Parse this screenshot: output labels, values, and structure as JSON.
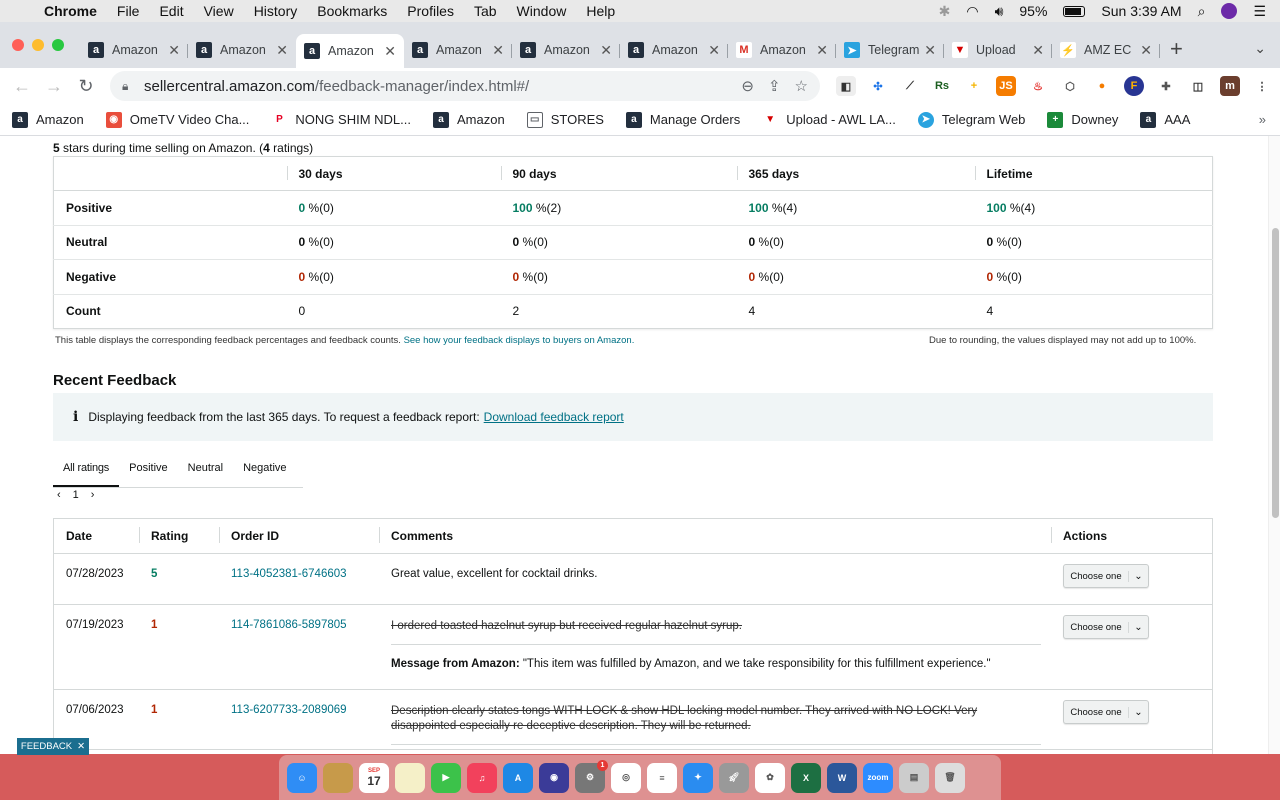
{
  "menubar": {
    "app_name": "Chrome",
    "items": [
      "File",
      "Edit",
      "View",
      "History",
      "Bookmarks",
      "Profiles",
      "Tab",
      "Window",
      "Help"
    ],
    "battery": "95%",
    "clock": "Sun 3:39 AM"
  },
  "tabs": [
    {
      "label": "Amazon",
      "favicon": "amazon-icon",
      "active": false
    },
    {
      "label": "Amazon",
      "favicon": "amazon-icon",
      "active": false
    },
    {
      "label": "Amazon",
      "favicon": "amazon-icon",
      "active": true
    },
    {
      "label": "Amazon",
      "favicon": "amazon-icon",
      "active": false
    },
    {
      "label": "Amazon",
      "favicon": "amazon-icon",
      "active": false
    },
    {
      "label": "Amazon",
      "favicon": "amazon-icon",
      "active": false
    },
    {
      "label": "Amazon",
      "favicon": "gmail-icon",
      "active": false
    },
    {
      "label": "Telegram",
      "favicon": "telegram-icon",
      "active": false
    },
    {
      "label": "Upload",
      "favicon": "upload-icon",
      "active": false
    },
    {
      "label": "AMZ EC",
      "favicon": "amz-ec-icon",
      "active": false
    }
  ],
  "omnibox": {
    "host": "sellercentral.amazon.com",
    "path": "/feedback-manager/index.html#/"
  },
  "bookmarks": [
    {
      "label": "Amazon",
      "icon": "amazon-icon"
    },
    {
      "label": "OmeTV Video Cha...",
      "icon": "ometv-icon"
    },
    {
      "label": "NONG SHIM NDL...",
      "icon": "pinterest-icon"
    },
    {
      "label": "Amazon",
      "icon": "amazon-icon"
    },
    {
      "label": "STORES",
      "icon": "folder-icon"
    },
    {
      "label": "Manage Orders",
      "icon": "amazon-icon"
    },
    {
      "label": "Upload - AWL LA...",
      "icon": "upload-icon"
    },
    {
      "label": "Telegram Web",
      "icon": "telegram-icon"
    },
    {
      "label": "Downey",
      "icon": "downey-icon"
    },
    {
      "label": "AAA",
      "icon": "amazon-icon"
    }
  ],
  "summary": {
    "lead": "5",
    "text_a": " stars during time selling on Amazon. (",
    "count": "4",
    "text_b": " ratings)"
  },
  "stats": {
    "headers": [
      "30 days",
      "90 days",
      "365 days",
      "Lifetime"
    ],
    "rows": [
      {
        "label": "Positive",
        "cells": [
          {
            "v": "0",
            "s": " %(0)",
            "c": "g"
          },
          {
            "v": "100",
            "s": " %(2)",
            "c": "g"
          },
          {
            "v": "100",
            "s": " %(4)",
            "c": "g"
          },
          {
            "v": "100",
            "s": " %(4)",
            "c": "g"
          }
        ]
      },
      {
        "label": "Neutral",
        "cells": [
          {
            "v": "0",
            "s": " %(0)",
            "c": ""
          },
          {
            "v": "0",
            "s": " %(0)",
            "c": ""
          },
          {
            "v": "0",
            "s": " %(0)",
            "c": ""
          },
          {
            "v": "0",
            "s": " %(0)",
            "c": ""
          }
        ]
      },
      {
        "label": "Negative",
        "cells": [
          {
            "v": "0",
            "s": " %(0)",
            "c": "r"
          },
          {
            "v": "0",
            "s": " %(0)",
            "c": "r"
          },
          {
            "v": "0",
            "s": " %(0)",
            "c": "r"
          },
          {
            "v": "0",
            "s": " %(0)",
            "c": "r"
          }
        ]
      },
      {
        "label": "Count",
        "cells": [
          {
            "v": "",
            "s": "0",
            "c": ""
          },
          {
            "v": "",
            "s": "2",
            "c": ""
          },
          {
            "v": "",
            "s": "4",
            "c": ""
          },
          {
            "v": "",
            "s": "4",
            "c": ""
          }
        ]
      }
    ],
    "note_left": "This table displays the corresponding feedback percentages and feedback counts.",
    "note_left_link": "See how your feedback displays to buyers on Amazon.",
    "note_right": "Due to rounding, the values displayed may not add up to 100%."
  },
  "recent": {
    "title": "Recent Feedback",
    "info_text": "Displaying feedback from the last 365 days. To request a feedback report:",
    "info_link": "Download feedback report",
    "filter_tabs": [
      "All ratings",
      "Positive",
      "Neutral",
      "Negative"
    ],
    "page": "1",
    "columns": [
      "Date",
      "Rating",
      "Order ID",
      "Comments",
      "Actions"
    ],
    "rows": [
      {
        "date": "07/28/2023",
        "rating": "5",
        "rating_color": "g",
        "order_id": "113-4052381-6746603",
        "comment": "Great value, excellent for cocktail drinks.",
        "struck": false,
        "amazon_label": "",
        "amazon_msg": "",
        "action": "Choose one"
      },
      {
        "date": "07/19/2023",
        "rating": "1",
        "rating_color": "r",
        "order_id": "114-7861086-5897805",
        "comment": "I ordered toasted hazelnut syrup but received regular hazelnut syrup.",
        "struck": true,
        "amazon_label": "Message from Amazon:",
        "amazon_msg": " \"This item was fulfilled by Amazon, and we take responsibility for this fulfillment experience.\"",
        "action": "Choose one"
      },
      {
        "date": "07/06/2023",
        "rating": "1",
        "rating_color": "r",
        "order_id": "113-6207733-2089069",
        "comment": "Description clearly states tongs WITH LOCK & show HDL locking model number. They arrived with NO LOCK! Very disappointed especially re deceptive description. They will be returned.",
        "struck": true,
        "amazon_label": "",
        "amazon_msg": "",
        "action": "Choose one"
      }
    ]
  },
  "feedback_tab": "FEEDBACK",
  "colors": {
    "positive": "#067d62",
    "negative": "#b12704",
    "link": "#007185",
    "desktop": "#d65b5b"
  },
  "dock": [
    "finder-icon",
    "notes-icon",
    "calendar-icon",
    "stickies-icon",
    "facetime-icon",
    "music-icon",
    "app-store-icon",
    "siri-icon",
    "system-preferences-icon",
    "chrome-icon",
    "reminders-icon",
    "safari-icon",
    "launchpad-icon",
    "photos-icon",
    "excel-icon",
    "word-icon",
    "zoom-icon",
    "preview-icon",
    "trash-icon"
  ],
  "dock_text": {
    "calendar_month": "SEP",
    "calendar_day": "17",
    "zoom": "zoom",
    "badge": "1"
  }
}
